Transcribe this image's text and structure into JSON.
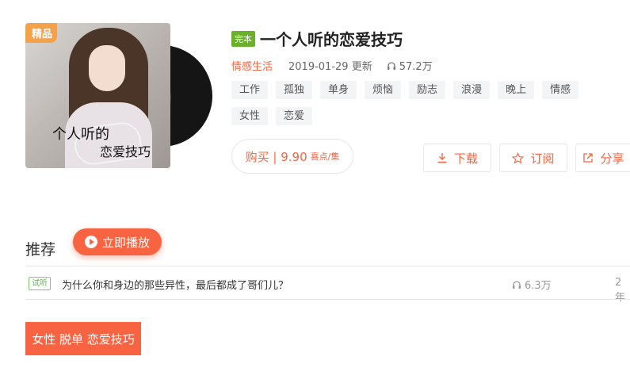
{
  "album": {
    "badge_premium": "精品",
    "cover_title_line1": "个人听的",
    "cover_title_line2": "恋爱技巧",
    "status_badge": "完本",
    "title": "一个人听的恋爱技巧",
    "category": "情感生活",
    "update_date": "2019-01-29 更新",
    "plays": "57.2万",
    "tags": [
      "工作",
      "孤独",
      "单身",
      "烦恼",
      "励志",
      "浪漫",
      "晚上",
      "情感",
      "女性",
      "恋爱"
    ]
  },
  "actions": {
    "buy_label": "购买 | 9.90",
    "buy_unit": "喜点/集",
    "download_label": "下载",
    "subscribe_label": "订阅",
    "share_label": "分享"
  },
  "recommend": {
    "heading": "推荐",
    "play_label": "立即播放"
  },
  "tracks": [
    {
      "badge": "试听",
      "title": "为什么你和身边的那些异性，最后都成了哥们儿？",
      "plays": "6.3万",
      "age": "2年"
    }
  ],
  "banner_text": "女性 脱单 恋爱技巧",
  "colors": {
    "accent": "#f86442",
    "premium": "#f5a14a",
    "complete": "#6ab02a",
    "trial": "#5bb84a"
  },
  "icons": {
    "headphone": "headphone-icon",
    "download": "download-icon",
    "star": "star-icon",
    "share": "share-icon",
    "play": "play-circle-icon"
  }
}
